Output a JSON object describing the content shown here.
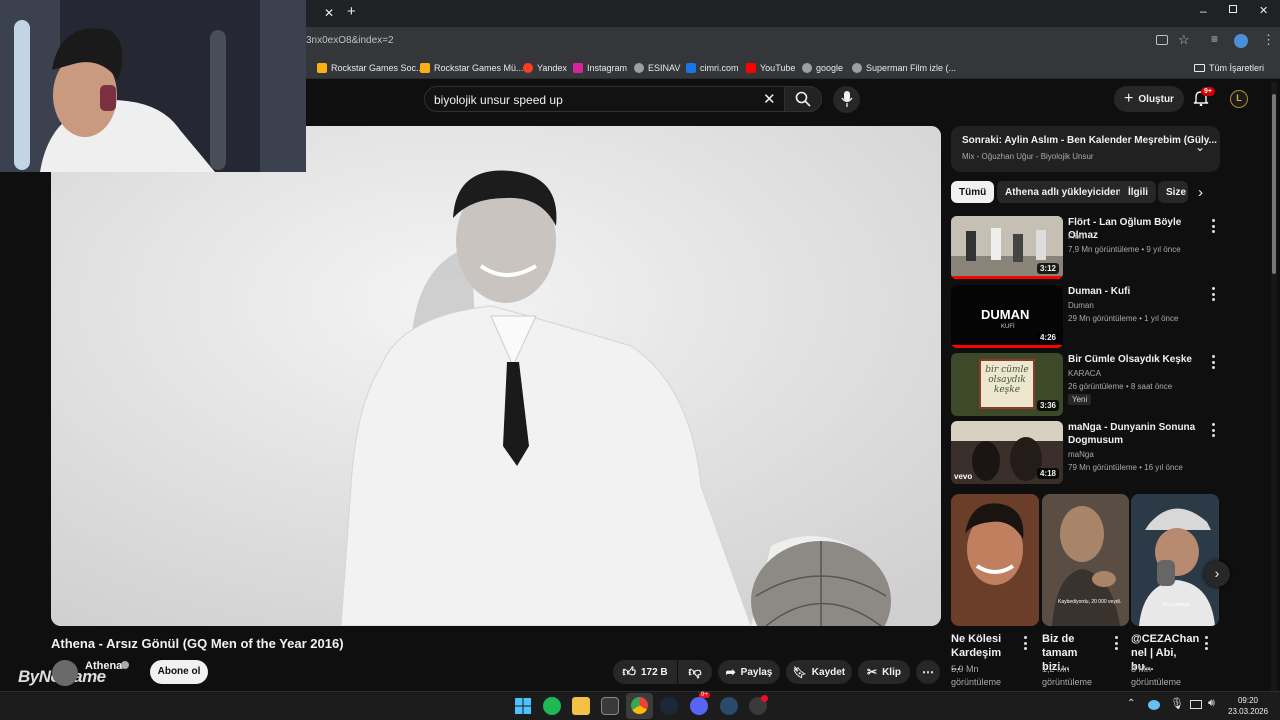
{
  "browser": {
    "tab_new": "+",
    "url": "3nx0exO8&index=2",
    "bookmarks": [
      {
        "label": "Rockstar Games Soc...",
        "color": "#fcaf17"
      },
      {
        "label": "Rockstar Games Mü...",
        "color": "#fcaf17"
      },
      {
        "label": "Yandex",
        "color": "#fc3f1d"
      },
      {
        "label": "Instagram",
        "color": "#d6249f"
      },
      {
        "label": "ESINAV",
        "color": "#9aa0a6"
      },
      {
        "label": "cimri.com",
        "color": "#1a73e8"
      },
      {
        "label": "YouTube",
        "color": "#ff0000"
      },
      {
        "label": "google",
        "color": "#9aa0a6"
      },
      {
        "label": "Superman Film izle (...",
        "color": "#9aa0a6"
      }
    ],
    "all_bookmarks": "Tüm İşaretleri"
  },
  "header": {
    "search_query": "biyolojik unsur speed up",
    "create_label": "Oluştur",
    "notif_badge": "9+",
    "avatar_letter": "L"
  },
  "video": {
    "title": "Athena - Arsız Gönül (GQ Men of the Year 2016)",
    "channel": "Athena",
    "subscribe": "Abone ol",
    "likes": "172 B",
    "share": "Paylaş",
    "save": "Kaydet",
    "clip": "Klip"
  },
  "watermark": "ByNoGame",
  "upnext": {
    "title": "Sonraki: Aylin Aslım - Ben Kalender Meşrebim (Güly...",
    "subtitle": "Mix - Oğuzhan Uğur - Biyolojik Unsur"
  },
  "chips": [
    "Tümü",
    "Athena adlı yükleyiciden",
    "İlgili",
    "Size"
  ],
  "recommendations": [
    {
      "title": "Flört - Lan Oğlum Böyle Olmaz",
      "channel": "Flört",
      "meta": "7,9 Mn görüntüleme • 9 yıl önce",
      "duration": "3:12",
      "thumb": "#b8b2a8"
    },
    {
      "title": "Duman - Kufi",
      "channel": "Duman",
      "meta": "29 Mn görüntüleme • 1 yıl önce",
      "duration": "4:26",
      "thumb": "#050505",
      "thumb_text": "DUMAN",
      "thumb_sub": "KUFİ"
    },
    {
      "title": "Bir Cümle Olsaydık Keşke",
      "channel": "KARACA",
      "meta": "26 görüntüleme • 8 saat önce",
      "duration": "3:36",
      "thumb": "#3d4a2a",
      "badge": "Yeni",
      "thumb_text": "bir cümle olsaydık keşke"
    },
    {
      "title": "maNga - Dunyanin Sonuna Dogmusum",
      "channel": "maNga",
      "meta": "79 Mn görüntüleme • 16 yıl önce",
      "duration": "4:18",
      "thumb": "#2a2320",
      "thumb_logo": "vevo"
    }
  ],
  "shorts": [
    {
      "title": "Ne Kölesi Kardeşim ...",
      "views": "5,9 Mn",
      "views2": "görüntüleme",
      "thumb": "#7a4a30"
    },
    {
      "title": "Biz de tamam bizi...",
      "views": "1,2 Mn",
      "views2": "görüntüleme",
      "thumb": "#6e6055",
      "caption": "Kaybediyordu, 20 000 veydi."
    },
    {
      "title": "@CEZAChan nel | Abi, bu...",
      "views": "8 Mn",
      "views2": "görüntüleme",
      "thumb": "#3a4a5a",
      "caption": "Bu kalmaya"
    }
  ],
  "taskbar": {
    "time": "09:20",
    "date": "23.03.2026",
    "badge_a": "9+"
  }
}
